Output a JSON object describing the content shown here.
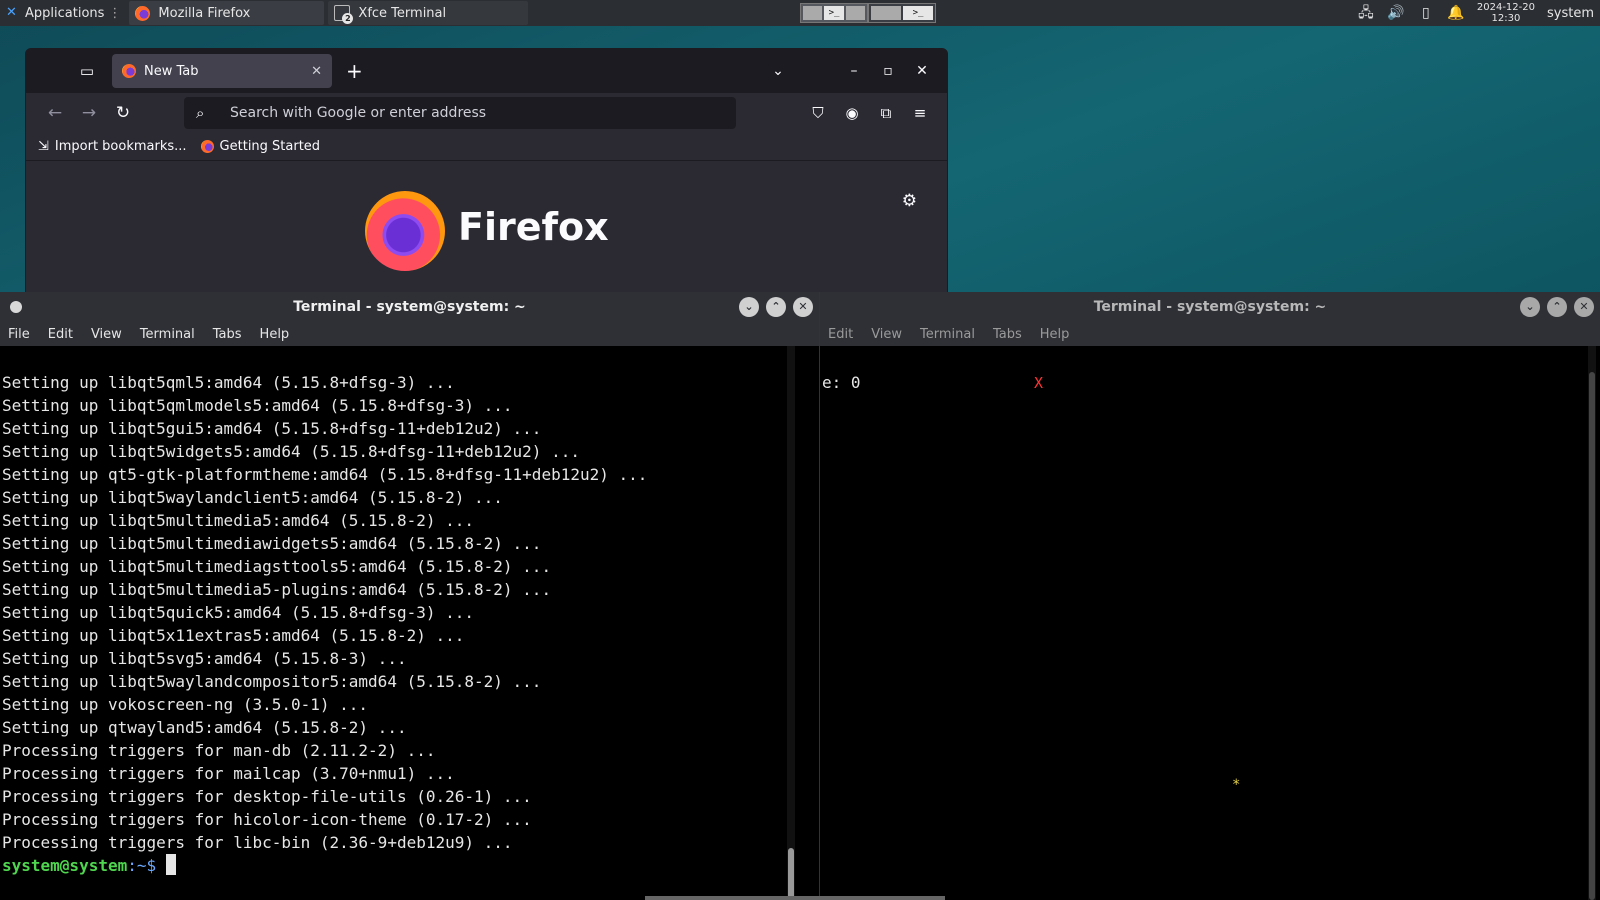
{
  "panel": {
    "applications_label": "Applications",
    "tasks": [
      {
        "label": "Mozilla Firefox"
      },
      {
        "label": "Xfce Terminal",
        "badge": "2"
      }
    ],
    "pager_term_glyph": ">_",
    "clock": {
      "date": "2024-12-20",
      "time": "12:30"
    },
    "user": "system"
  },
  "firefox": {
    "tab_title": "New Tab",
    "url_placeholder": "Search with Google or enter address",
    "bookmarks": [
      "Import bookmarks...",
      "Getting Started"
    ],
    "wordmark": "Firefox"
  },
  "terminal_left": {
    "title": "Terminal - system@system: ~",
    "menu": [
      "File",
      "Edit",
      "View",
      "Terminal",
      "Tabs",
      "Help"
    ],
    "lines": [
      "Setting up libqt5qml5:amd64 (5.15.8+dfsg-3) ...",
      "Setting up libqt5qmlmodels5:amd64 (5.15.8+dfsg-3) ...",
      "Setting up libqt5gui5:amd64 (5.15.8+dfsg-11+deb12u2) ...",
      "Setting up libqt5widgets5:amd64 (5.15.8+dfsg-11+deb12u2) ...",
      "Setting up qt5-gtk-platformtheme:amd64 (5.15.8+dfsg-11+deb12u2) ...",
      "Setting up libqt5waylandclient5:amd64 (5.15.8-2) ...",
      "Setting up libqt5multimedia5:amd64 (5.15.8-2) ...",
      "Setting up libqt5multimediawidgets5:amd64 (5.15.8-2) ...",
      "Setting up libqt5multimediagsttools5:amd64 (5.15.8-2) ...",
      "Setting up libqt5multimedia5-plugins:amd64 (5.15.8-2) ...",
      "Setting up libqt5quick5:amd64 (5.15.8+dfsg-3) ...",
      "Setting up libqt5x11extras5:amd64 (5.15.8-2) ...",
      "Setting up libqt5svg5:amd64 (5.15.8-3) ...",
      "Setting up libqt5waylandcompositor5:amd64 (5.15.8-2) ...",
      "Setting up vokoscreen-ng (3.5.0-1) ...",
      "Setting up qtwayland5:amd64 (5.15.8-2) ...",
      "Processing triggers for man-db (2.11.2-2) ...",
      "Processing triggers for mailcap (3.70+nmu1) ...",
      "Processing triggers for desktop-file-utils (0.26-1) ...",
      "Processing triggers for hicolor-icon-theme (0.17-2) ...",
      "Processing triggers for libc-bin (2.36-9+deb12u9) ..."
    ],
    "prompt_user": "system@system",
    "prompt_path": ":~$"
  },
  "terminal_right": {
    "title": "Terminal - system@system: ~",
    "menu": [
      "Edit",
      "View",
      "Terminal",
      "Tabs",
      "Help"
    ],
    "line1": "e: 0",
    "red_mark": "X",
    "star_mark": "*"
  }
}
